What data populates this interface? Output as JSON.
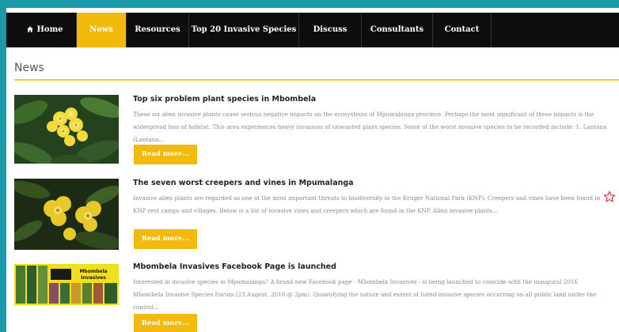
{
  "nav": {
    "items": [
      {
        "label": "Home",
        "icon": "home-icon"
      },
      {
        "label": "News"
      },
      {
        "label": "Resources"
      },
      {
        "label": "Top 20 Invasive Species"
      },
      {
        "label": "Discuss"
      },
      {
        "label": "Consultants"
      },
      {
        "label": "Contact"
      }
    ],
    "active": "News"
  },
  "page": {
    "title": "News"
  },
  "articles": [
    {
      "title": "Top six problem plant species in Mbombela",
      "excerpt": "These six alien invasive plants cause serious negative impacts on the ecosystems of Mpumalanga province. Perhaps the most significant of these impacts is the widespread loss of habitat. This area experiences heavy invasions of unwanted plant species. Some of the worst invasive species to be recorded include: 1. Lantana (Lantana...",
      "button": "Read more..."
    },
    {
      "title": "The seven worst creepers and vines in Mpumalanga",
      "excerpt": "Invasive alien plants are regarded as one of the most important threats to biodiversity in the Kruger National Park (KNP). Creepers and vines have been found in KNP rest camps and villages. Below is a list of invasive vines and creepers which are found in the KNP. Alien invasive plants...",
      "button": "Read more..."
    },
    {
      "title": "Mbombela Invasives Facebook Page is launched",
      "excerpt": "Interested in invasive species in Mpumalanga? A brand new Facebook page - Mbombela Invasives - is being launched to coincide with the inaugural 2016 Mbombela Invasive Species Forum (23 August, 2016 @ 2pm). Quantifying the nature and extent of listed invasive species occurring on all public land under the control...",
      "button": "Read more...",
      "thumb_text": "Mbombela Invasives"
    }
  ],
  "colors": {
    "accent": "#f2b90f",
    "nav_bg": "#0d0d0d",
    "page_bg": "#1a9aa8",
    "rule": "#f2cc3a",
    "star": "#e0304a"
  }
}
